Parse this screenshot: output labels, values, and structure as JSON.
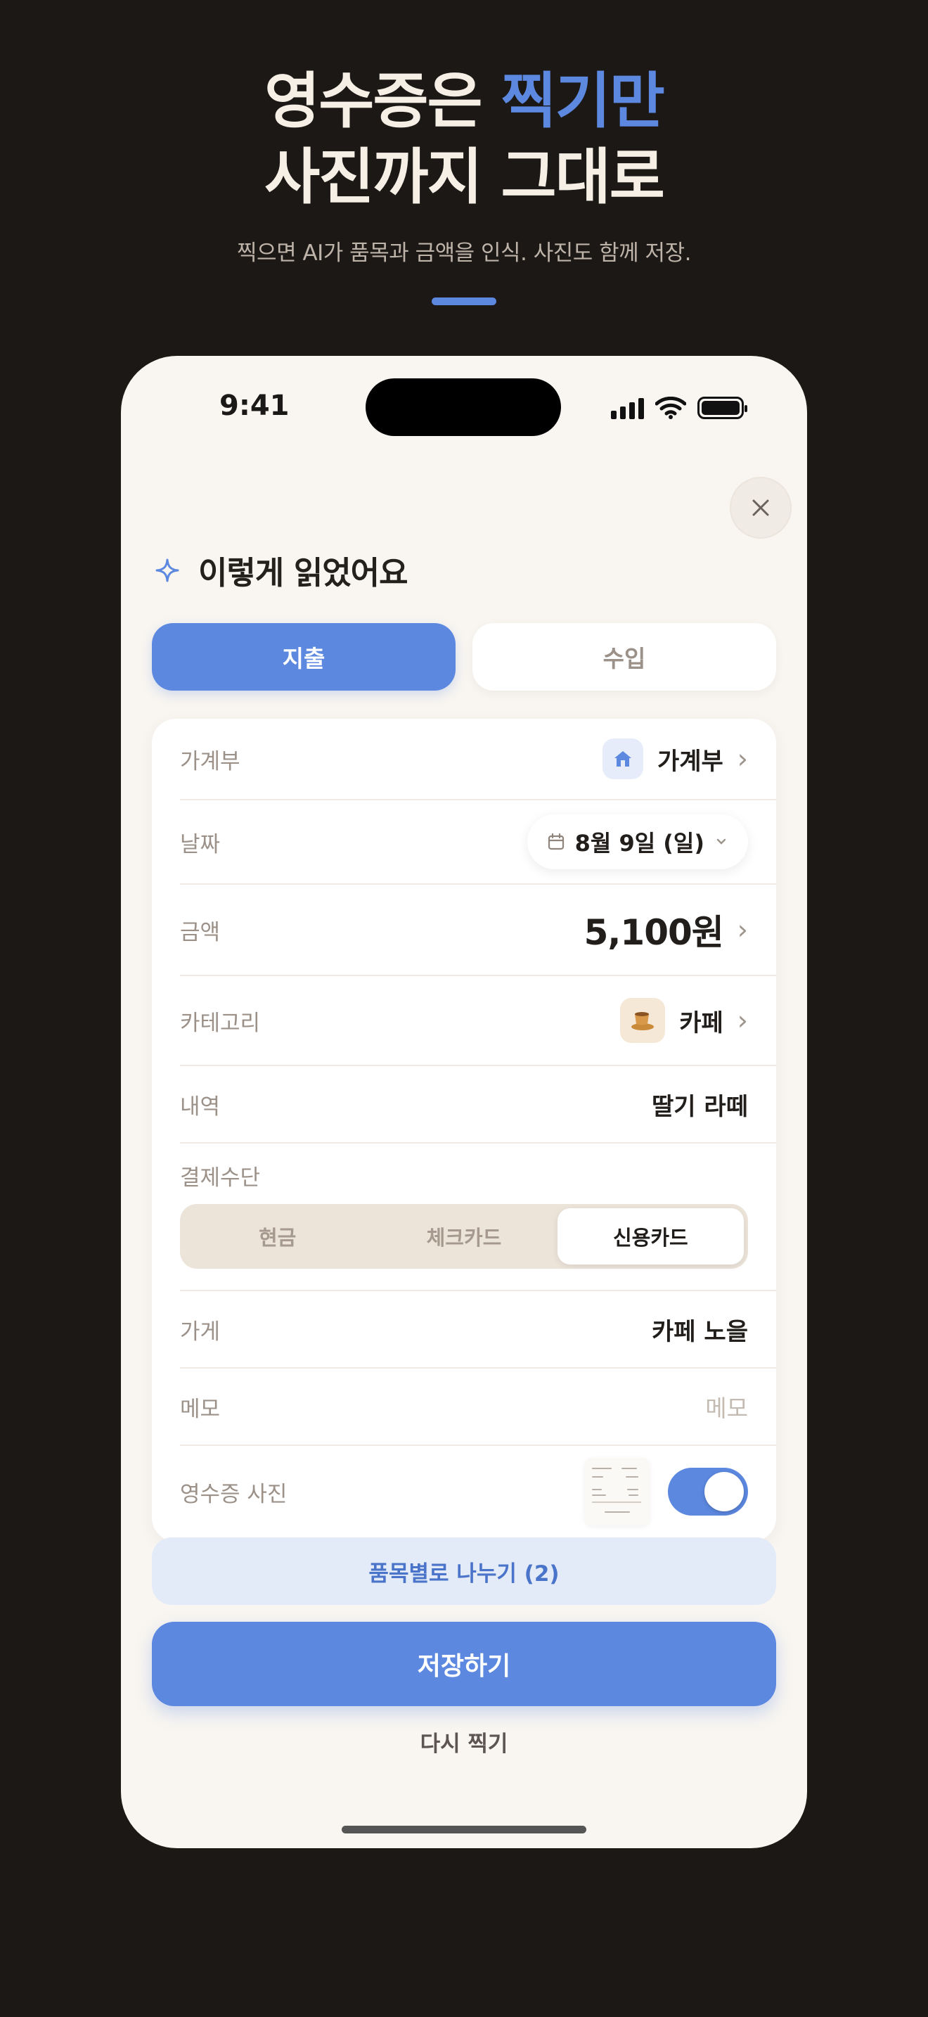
{
  "hero": {
    "line1_plain": "영수증은 ",
    "line1_accent": "찍기만",
    "line2": "사진까지 그대로",
    "subtitle": "찍으면 AI가 품목과 금액을 인식. 사진도 함께 저장.",
    "accent_color": "#5c88e0"
  },
  "status_bar": {
    "time": "9:41"
  },
  "sheet": {
    "title": "이렇게 읽었어요",
    "tabs": [
      {
        "label": "지출",
        "active": true
      },
      {
        "label": "수입",
        "active": false
      }
    ],
    "fields": {
      "ledger": {
        "label": "가계부",
        "value": "가계부",
        "icon": "house-icon"
      },
      "date": {
        "label": "날짜",
        "value": "8월 9일 (일)",
        "icon": "calendar-icon"
      },
      "amount": {
        "label": "금액",
        "value": "5,100원"
      },
      "category": {
        "label": "카테고리",
        "value": "카페",
        "icon": "coffee-cup-icon"
      },
      "description": {
        "label": "내역",
        "value": "딸기 라떼"
      },
      "payment": {
        "label": "결제수단",
        "options": [
          "현금",
          "체크카드",
          "신용카드"
        ],
        "selected": "신용카드"
      },
      "store": {
        "label": "가게",
        "value": "카페 노을"
      },
      "memo": {
        "label": "메모",
        "placeholder": "메모"
      },
      "receipt_photo": {
        "label": "영수증 사진",
        "toggle_on": true
      }
    },
    "split_button": "품목별로 나누기 (2)",
    "save_button": "저장하기",
    "retake_button": "다시 찍기"
  }
}
